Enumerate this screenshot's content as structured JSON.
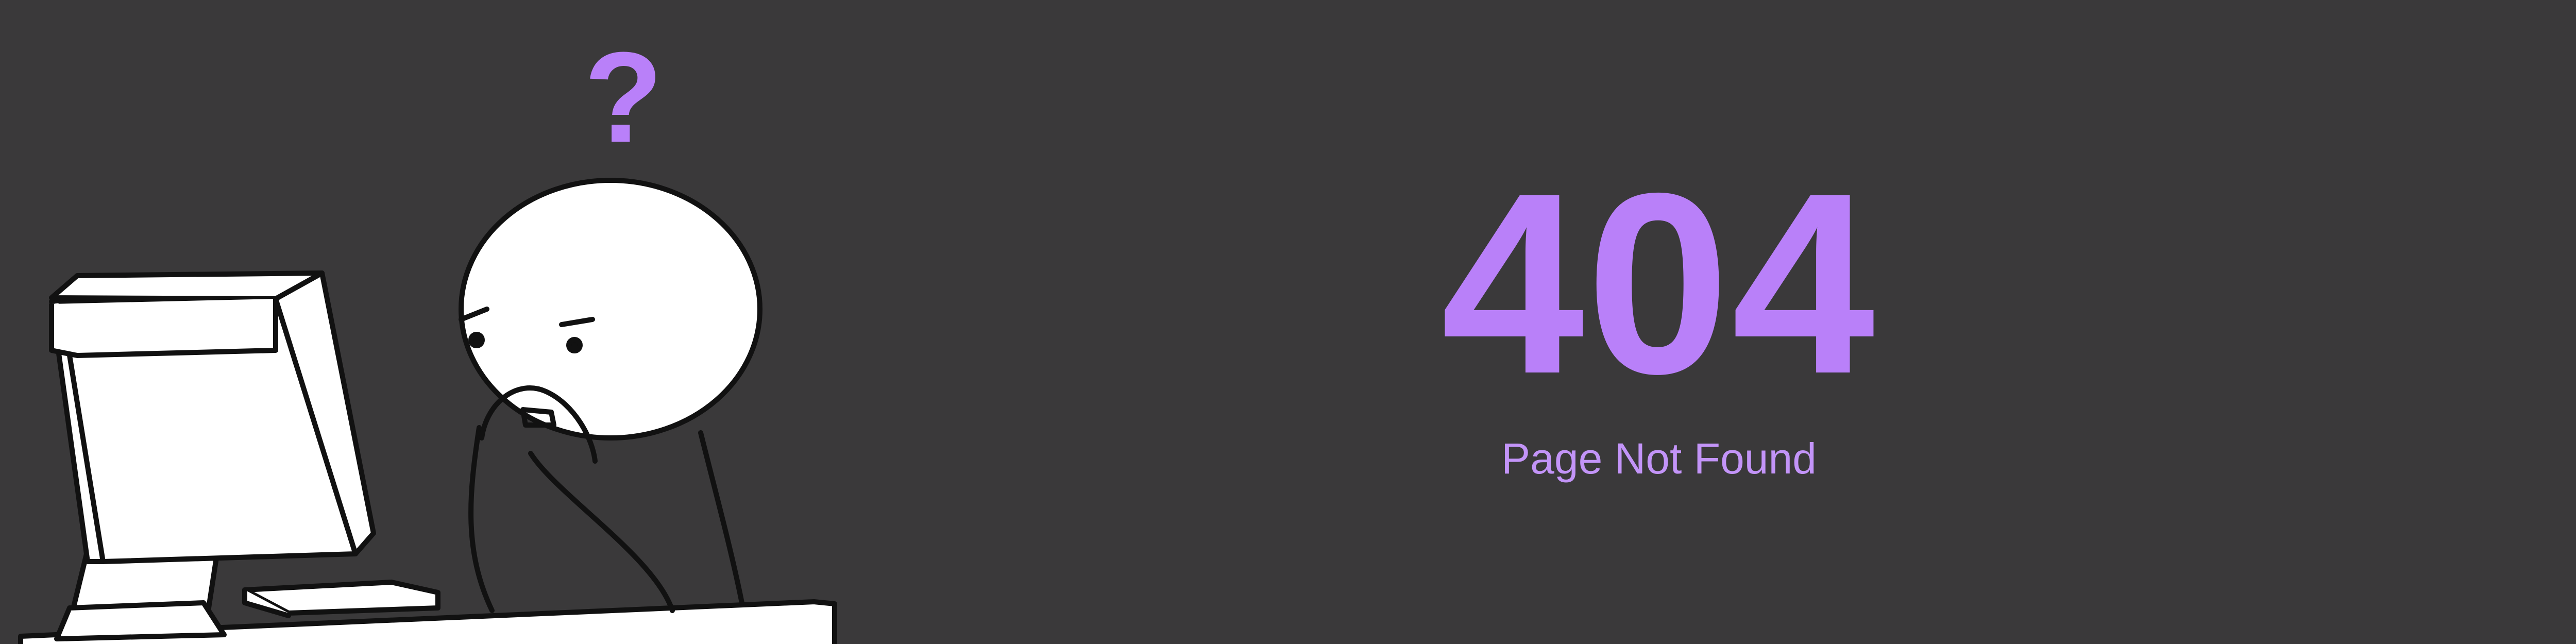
{
  "error": {
    "code": "404",
    "message": "Page Not Found"
  },
  "illustration": {
    "question_mark": "?"
  },
  "colors": {
    "background": "#3a393a",
    "accent": "#b980f9",
    "accent_light": "#c394f8",
    "line_art": "#111111",
    "fill": "#ffffff"
  }
}
